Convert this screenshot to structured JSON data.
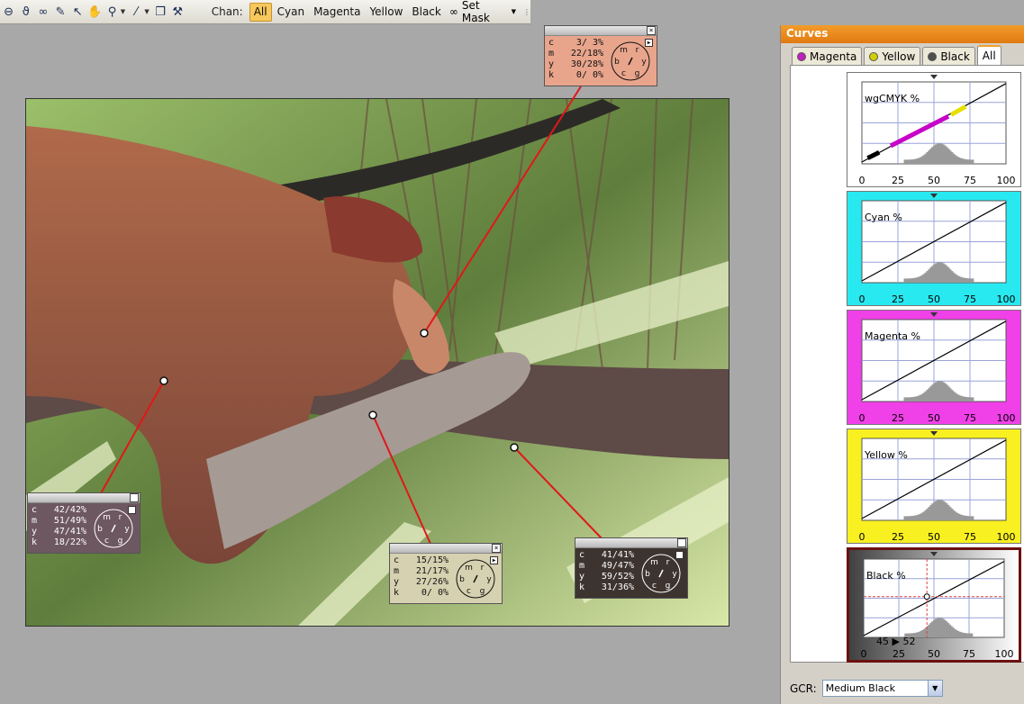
{
  "toolbar": {
    "chan_label": "Chan:",
    "channels": [
      "All",
      "Cyan",
      "Magenta",
      "Yellow",
      "Black"
    ],
    "active_channel": "All",
    "set_mask_label": "Set Mask",
    "icons": [
      "zoom-out-icon",
      "lasso-icon",
      "mask-icon",
      "pen-icon",
      "pointer-icon",
      "hand-icon",
      "zoom-icon",
      "eyedropper-icon",
      "copy-icon",
      "wrench-icon"
    ]
  },
  "probes": [
    {
      "bg": "#e8a58c",
      "fg": "#111111",
      "rows": [
        {
          "ch": "c",
          "v": "3/ 3%"
        },
        {
          "ch": "m",
          "v": "22/18%"
        },
        {
          "ch": "y",
          "v": "30/28%"
        },
        {
          "ch": "k",
          "v": "0/ 0%"
        }
      ]
    },
    {
      "bg": "#6d5760",
      "fg": "#ffffff",
      "rows": [
        {
          "ch": "c",
          "v": "42/42%"
        },
        {
          "ch": "m",
          "v": "51/49%"
        },
        {
          "ch": "y",
          "v": "47/41%"
        },
        {
          "ch": "k",
          "v": "18/22%"
        }
      ]
    },
    {
      "bg": "#d6d1b0",
      "fg": "#111111",
      "rows": [
        {
          "ch": "c",
          "v": "15/15%"
        },
        {
          "ch": "m",
          "v": "21/17%"
        },
        {
          "ch": "y",
          "v": "27/26%"
        },
        {
          "ch": "k",
          "v": "0/ 0%"
        }
      ]
    },
    {
      "bg": "#3d3430",
      "fg": "#ffffff",
      "rows": [
        {
          "ch": "c",
          "v": "41/41%"
        },
        {
          "ch": "m",
          "v": "49/47%"
        },
        {
          "ch": "y",
          "v": "59/52%"
        },
        {
          "ch": "k",
          "v": "31/36%"
        }
      ]
    }
  ],
  "dial_letters": [
    "r",
    "y",
    "g",
    "c",
    "b",
    "m"
  ],
  "panel": {
    "title": "Curves",
    "tabs": [
      {
        "label": "Magenta",
        "dot": "#c020c0",
        "active": false
      },
      {
        "label": "Yellow",
        "dot": "#d0d000",
        "active": false
      },
      {
        "label": "Black",
        "dot": "#505050",
        "active": false
      },
      {
        "label": "All",
        "dot": "",
        "active": true
      }
    ],
    "curves": [
      {
        "title": "wgCMYK %",
        "tint": "#ffffff",
        "selected": false,
        "read": ""
      },
      {
        "title": "Cyan %",
        "tint": "#28e8f0",
        "selected": false,
        "read": ""
      },
      {
        "title": "Magenta %",
        "tint": "#f040e8",
        "selected": false,
        "read": ""
      },
      {
        "title": "Yellow %",
        "tint": "#f8f020",
        "selected": false,
        "read": ""
      },
      {
        "title": "Black %",
        "tint": "#404040",
        "selected": true,
        "read": "45 ▶ 52"
      }
    ],
    "ticks": [
      "0",
      "25",
      "50",
      "75",
      "100"
    ],
    "gcr_label": "GCR:",
    "gcr_value": "Medium Black"
  }
}
